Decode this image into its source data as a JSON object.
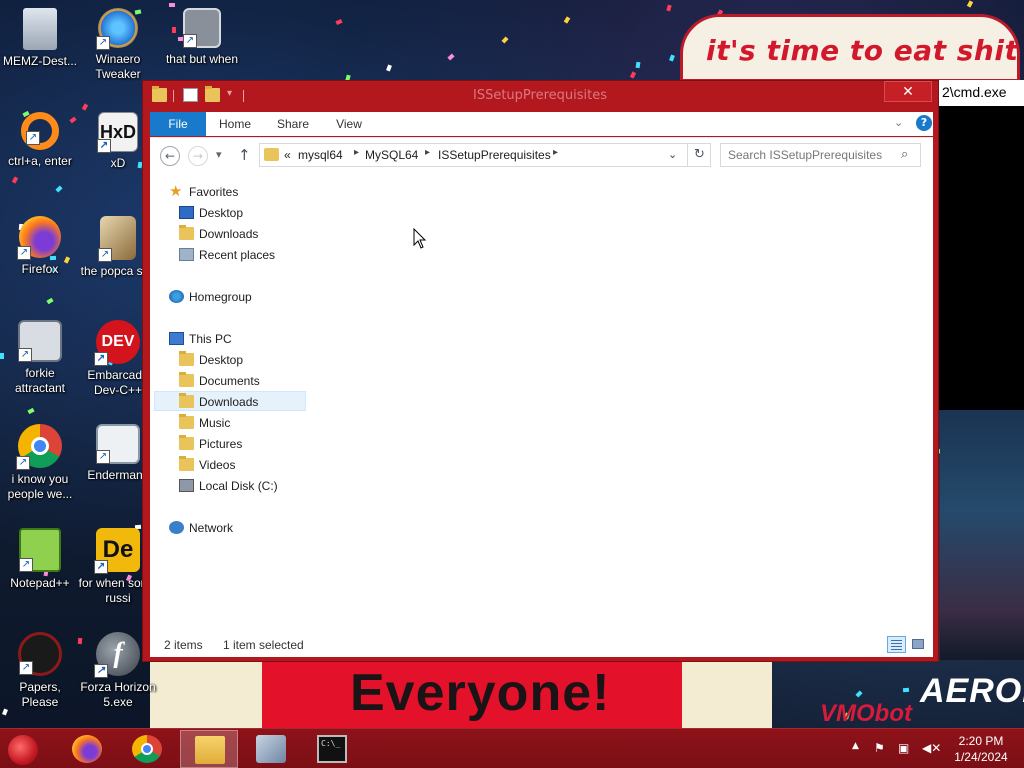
{
  "desktop": {
    "icons": [
      {
        "label": "MEMZ-Dest...",
        "icon": "recycle-bin-icon"
      },
      {
        "label": "Winaero Tweaker",
        "icon": "winaero-icon"
      },
      {
        "label": "that but when its a #",
        "icon": "documents-stack-icon"
      },
      {
        "label": "ctrl+a, enter",
        "icon": "ring-icon"
      },
      {
        "label": "xD",
        "icon": "hxd-icon"
      },
      {
        "label": "Firefox",
        "icon": "firefox-icon"
      },
      {
        "label": "the popca shit",
        "icon": "popcat-icon"
      },
      {
        "label": "forkie attractant",
        "icon": "control-panel-icon"
      },
      {
        "label": "Embarcade Dev-C++",
        "icon": "devcpp-icon"
      },
      {
        "label": "i know you people we...",
        "icon": "chrome-icon"
      },
      {
        "label": "Endermanc",
        "icon": "window-icon"
      },
      {
        "label": "Notepad++",
        "icon": "notepadpp-icon"
      },
      {
        "label": "for when some russi",
        "icon": "de-icon"
      },
      {
        "label": "Papers, Please",
        "icon": "papers-please-icon"
      },
      {
        "label": "Forza Horizon 5.exe",
        "icon": "flash-icon"
      }
    ]
  },
  "wallpaper": {
    "top_banner": "it's time to eat shit",
    "bottom_banner": "Everyone!",
    "cmd_title": "2\\cmd.exe",
    "right_caption": "AEROFOS",
    "right_caption_sub": "VMObot"
  },
  "explorer": {
    "title": "ISSetupPrerequisites",
    "close_label": "✕",
    "ribbon": {
      "tabs": [
        "File",
        "Home",
        "Share",
        "View"
      ],
      "help_label": "?"
    },
    "address": {
      "overflow": "«",
      "crumbs": [
        "mysql64",
        "MySQL64",
        "ISSetupPrerequisites"
      ]
    },
    "search": {
      "placeholder": "Search ISSetupPrerequisites"
    },
    "nav": {
      "favorites_label": "Favorites",
      "favorites": [
        "Desktop",
        "Downloads",
        "Recent places"
      ],
      "homegroup_label": "Homegroup",
      "thispc_label": "This PC",
      "thispc": [
        "Desktop",
        "Documents",
        "Downloads",
        "Music",
        "Pictures",
        "Videos",
        "Local Disk (C:)"
      ],
      "network_label": "Network"
    },
    "status": {
      "item_count": "2 items",
      "selection": "1 item selected"
    }
  },
  "taskbar": {
    "clock_time": "2:20 PM",
    "clock_date": "1/24/2024",
    "pinned": [
      "firefox-icon",
      "chrome-icon",
      "file-explorer-icon",
      "network-setup-icon",
      "cmd-icon"
    ],
    "active_index": 2
  },
  "colors": {
    "window_frame": "#b4181f",
    "taskbar": "#7b0f15",
    "accent": "#1979ca"
  }
}
